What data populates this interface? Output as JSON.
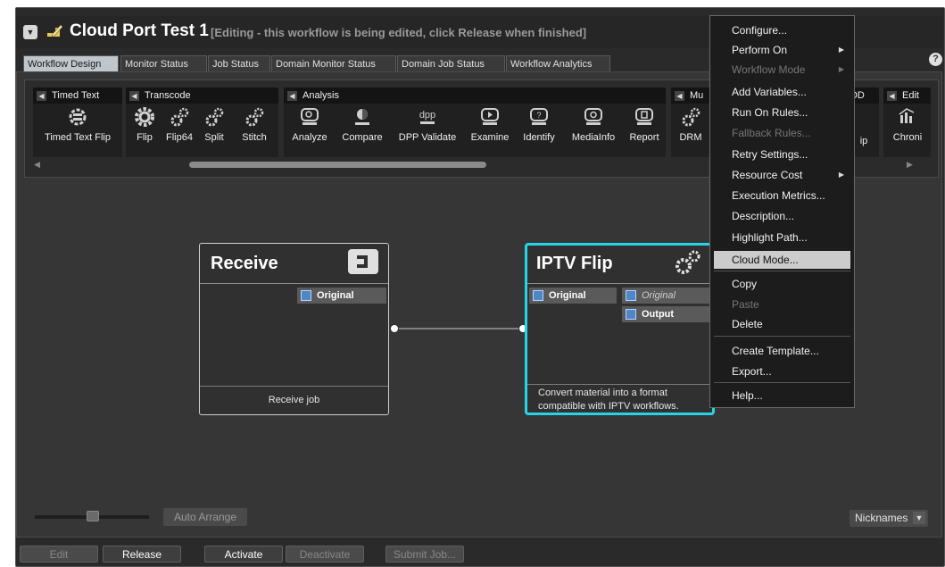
{
  "workflow": {
    "name": "Cloud Port Test 1",
    "status_note": "[Editing - this workflow is being edited, click Release when finished]"
  },
  "tabs": [
    {
      "label": "Workflow Design",
      "active": true
    },
    {
      "label": "Monitor Status"
    },
    {
      "label": "Job Status"
    },
    {
      "label": "Domain Monitor Status"
    },
    {
      "label": "Domain Job Status"
    },
    {
      "label": "Workflow Analytics"
    }
  ],
  "help_label": "?",
  "toolbox": {
    "groups": [
      {
        "name": "Timed Text",
        "tools": [
          {
            "label": "Timed Text Flip",
            "icon": "timed-text-flip-icon"
          }
        ]
      },
      {
        "name": "Transcode",
        "tools": [
          {
            "label": "Flip",
            "icon": "gear-icon"
          },
          {
            "label": "Flip64",
            "icon": "gears-icon"
          },
          {
            "label": "Split",
            "icon": "gears-icon"
          },
          {
            "label": "Stitch",
            "icon": "gears-icon"
          }
        ]
      },
      {
        "name": "Analysis",
        "tools": [
          {
            "label": "Analyze",
            "icon": "analyze-icon"
          },
          {
            "label": "Compare",
            "icon": "compare-icon"
          },
          {
            "label": "DPP Validate",
            "icon": "dpp-icon"
          },
          {
            "label": "Examine",
            "icon": "examine-icon"
          },
          {
            "label": "Identify",
            "icon": "identify-icon"
          },
          {
            "label": "MediaInfo",
            "icon": "mediainfo-icon"
          },
          {
            "label": "Report",
            "icon": "report-icon"
          }
        ]
      },
      {
        "name": "Mu",
        "tools": [
          {
            "label": "DRM",
            "icon": "gears-icon"
          }
        ]
      },
      {
        "name": "VOD",
        "tools": [
          {
            "label": "ip",
            "icon": ""
          }
        ]
      },
      {
        "name": "Edit",
        "tools": [
          {
            "label": "Chroni",
            "icon": "chroni-icon"
          }
        ]
      }
    ]
  },
  "nodes": {
    "receive": {
      "title": "Receive",
      "output_port": "Original",
      "description": "Receive job"
    },
    "iptv": {
      "title": "IPTV Flip",
      "input_port": "Original",
      "output_ports": [
        "Original",
        "Output"
      ],
      "description": "Convert material into a format compatible with IPTV workflows."
    }
  },
  "controls": {
    "auto_arrange": "Auto Arrange",
    "nicknames": "Nicknames",
    "buttons": {
      "edit": "Edit",
      "release": "Release",
      "activate": "Activate",
      "deactivate": "Deactivate",
      "submit_job": "Submit Job..."
    }
  },
  "context_menu": {
    "items": [
      {
        "label": "Configure..."
      },
      {
        "label": "Perform On",
        "submenu": true
      },
      {
        "label": "Workflow Mode",
        "submenu": true,
        "disabled": true
      },
      {
        "label": "Add Variables..."
      },
      {
        "label": "Run On Rules..."
      },
      {
        "label": "Fallback Rules...",
        "disabled": true
      },
      {
        "label": "Retry Settings..."
      },
      {
        "label": "Resource Cost",
        "submenu": true
      },
      {
        "label": "Execution Metrics..."
      },
      {
        "label": "Description..."
      },
      {
        "label": "Highlight Path..."
      },
      {
        "label": "Cloud Mode...",
        "highlighted": true
      },
      {
        "label": "Copy"
      },
      {
        "label": "Paste",
        "disabled": true
      },
      {
        "label": "Delete"
      },
      {
        "label": "Create Template..."
      },
      {
        "label": "Export..."
      },
      {
        "label": "Help..."
      }
    ]
  },
  "colors": {
    "selection_accent": "#27d3e8",
    "background": "#363636"
  }
}
